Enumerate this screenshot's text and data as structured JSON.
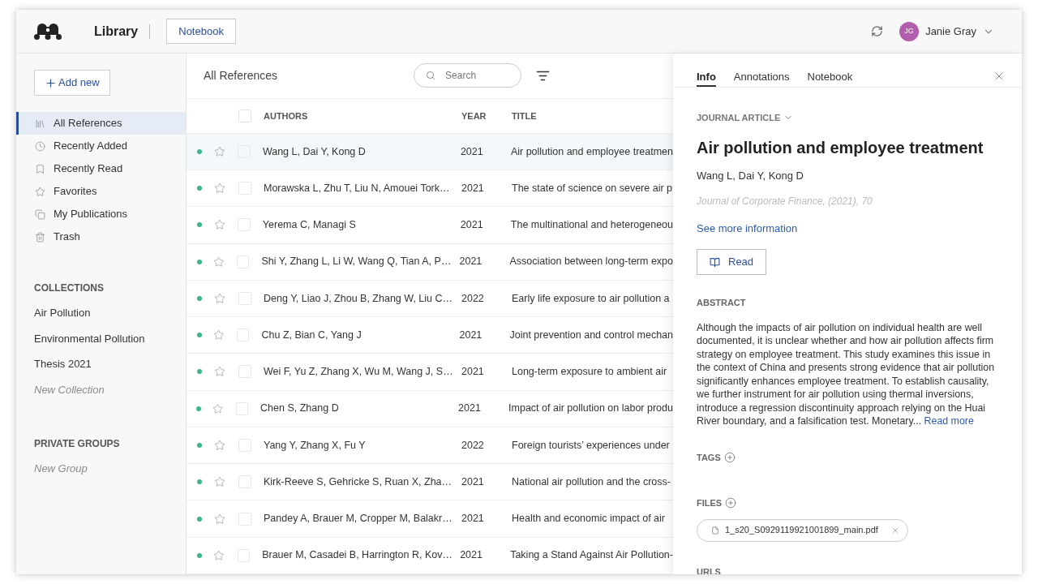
{
  "header": {
    "section": "Library",
    "notebook_button": "Notebook",
    "user": {
      "initials": "JG",
      "name": "Janie Gray"
    }
  },
  "sidebar": {
    "add_button": "Add new",
    "items": [
      {
        "label": "All References",
        "selected": true
      },
      {
        "label": "Recently Added",
        "selected": false
      },
      {
        "label": "Recently Read",
        "selected": false
      },
      {
        "label": "Favorites",
        "selected": false
      },
      {
        "label": "My Publications",
        "selected": false
      },
      {
        "label": "Trash",
        "selected": false
      }
    ],
    "collections": {
      "heading": "COLLECTIONS",
      "items": [
        {
          "label": "Air Pollution",
          "kind": "item"
        },
        {
          "label": "Environmental Pollution",
          "kind": "item"
        },
        {
          "label": "Thesis 2021",
          "kind": "item"
        },
        {
          "label": "New Collection",
          "kind": "new"
        }
      ]
    },
    "groups": {
      "heading": "PRIVATE GROUPS",
      "items": [
        {
          "label": "New Group",
          "kind": "new"
        }
      ]
    }
  },
  "references": {
    "title": "All References",
    "search": {
      "placeholder": "Search"
    },
    "select_all": {
      "checked": false
    },
    "columns": [
      "AUTHORS",
      "YEAR",
      "TITLE"
    ],
    "rows": [
      {
        "authors": "Wang L, Dai Y, Kong D",
        "year": "2021",
        "title": "Air pollution and employee treatmen",
        "unread": true,
        "starred": false,
        "checked": false,
        "selected": true
      },
      {
        "authors": "Morawska L, Zhu T, Liu N, Amouei Tork…",
        "year": "2021",
        "title": "The state of science on severe air p",
        "unread": true,
        "starred": false,
        "checked": false,
        "selected": false
      },
      {
        "authors": "Yerema C, Managi S",
        "year": "2021",
        "title": "The multinational and heterogeneou",
        "unread": true,
        "starred": false,
        "checked": false,
        "selected": false
      },
      {
        "authors": "Shi Y, Zhang L, Li W, Wang Q, Tian A, P…",
        "year": "2021",
        "title": "Association between long-term expo",
        "unread": true,
        "starred": false,
        "checked": false,
        "selected": false
      },
      {
        "authors": "Deng Y, Liao J, Zhou B, Zhang W, Liu C…",
        "year": "2022",
        "title": "Early life exposure to air pollution a",
        "unread": true,
        "starred": false,
        "checked": false,
        "selected": false
      },
      {
        "authors": "Chu Z, Bian C, Yang J",
        "year": "2021",
        "title": "Joint prevention and control mechan",
        "unread": true,
        "starred": false,
        "checked": false,
        "selected": false
      },
      {
        "authors": "Wei F, Yu Z, Zhang X, Wu M, Wang J, S…",
        "year": "2021",
        "title": "Long-term exposure to ambient air",
        "unread": true,
        "starred": false,
        "checked": false,
        "selected": false
      },
      {
        "authors": "Chen S, Zhang D",
        "year": "2021",
        "title": "Impact of air pollution on labor produ",
        "unread": true,
        "starred": false,
        "checked": false,
        "selected": false
      },
      {
        "authors": "Yang Y, Zhang X, Fu Y",
        "year": "2022",
        "title": "Foreign tourists’ experiences under",
        "unread": true,
        "starred": false,
        "checked": false,
        "selected": false
      },
      {
        "authors": "Kirk-Reeve S, Gehricke S, Ruan X, Zha…",
        "year": "2021",
        "title": "National air pollution and the cross-",
        "unread": true,
        "starred": false,
        "checked": false,
        "selected": false
      },
      {
        "authors": "Pandey A, Brauer M, Cropper M, Balakr…",
        "year": "2021",
        "title": "Health and economic impact of air",
        "unread": true,
        "starred": false,
        "checked": false,
        "selected": false
      },
      {
        "authors": "Brauer M, Casadei B, Harrington R, Kov…",
        "year": "2021",
        "title": "Taking a Stand Against Air Pollution-",
        "unread": true,
        "starred": false,
        "checked": false,
        "selected": false
      }
    ]
  },
  "details": {
    "tabs": [
      {
        "label": "Info",
        "selected": true
      },
      {
        "label": "Annotations",
        "selected": false
      },
      {
        "label": "Notebook",
        "selected": false
      }
    ],
    "type": "JOURNAL ARTICLE",
    "title": "Air pollution and employee treatment",
    "authors": "Wang L, Dai Y, Kong D",
    "source": "Journal of Corporate Finance, (2021), 70",
    "more_link": "See more information",
    "read_button": "Read",
    "abstract": {
      "heading": "ABSTRACT",
      "text": "Although the impacts of air pollution on individual health are well documented, it is unclear whether and how air pollution affects firm strategy on employee treatment. This study examines this issue in the context of China and presents strong evidence that air pollution significantly enhances employee treatment. To establish causality, we further instrument for air pollution using thermal inversions, introduce a regression discontinuity approach relying on the Huai River boundary, and a falsification test. Monetary...",
      "read_more": "Read more"
    },
    "tags_heading": "TAGS",
    "files_heading": "FILES",
    "files": [
      "1_s20_S0929119921001899_main.pdf"
    ],
    "urls_heading": "URLS"
  }
}
